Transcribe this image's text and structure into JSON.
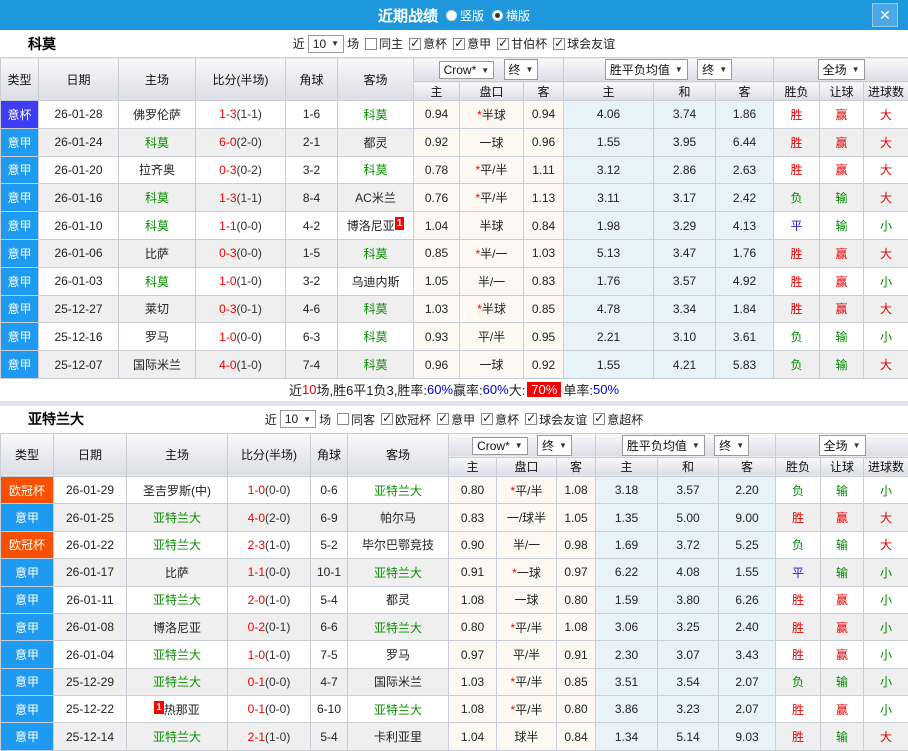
{
  "titlebar": {
    "title": "近期战绩",
    "vertical_label": "竖版",
    "horizontal_label": "横版",
    "close_glyph": "✕"
  },
  "league_colors": {
    "意杯": "#3D3DF5",
    "意甲": "#1E9AF0",
    "欧冠杯": "#F75000"
  },
  "result_colors": {
    "胜": "#E60000",
    "平": "#1A1AE6",
    "负": "#008800",
    "赢": "#E60000",
    "输": "#008800",
    "大": "#E60000",
    "小": "#008800"
  },
  "sections": [
    {
      "team": "科莫",
      "filter": {
        "near_label": "近",
        "count": "10",
        "games_label": "场",
        "same_label": "同主",
        "same_checked": false,
        "leagues": [
          "意杯",
          "意甲",
          "甘伯杯",
          "球会友谊"
        ]
      },
      "selects": {
        "odds_src": "Crow*",
        "odds_time": "终",
        "mean": "胜平负均值",
        "mean_time": "终",
        "scope": "全场"
      },
      "columns": [
        "类型",
        "日期",
        "主场",
        "比分(半场)",
        "角球",
        "客场"
      ],
      "subcols": [
        "主",
        "盘口",
        "客",
        "主",
        "和",
        "客",
        "胜负",
        "让球",
        "进球数"
      ],
      "rows": [
        {
          "league": "意杯",
          "date": "26-01-28",
          "home": "佛罗伦萨",
          "home_sel": false,
          "home_card": "",
          "score": "1-3",
          "half": "(1-1)",
          "corners": "1-6",
          "away": "科莫",
          "away_sel": true,
          "away_card": "",
          "odds_home": "0.94",
          "handicap": "*半球",
          "odds_away": "0.94",
          "avg_home": "4.06",
          "avg_draw": "3.74",
          "avg_away": "1.86",
          "result": "胜",
          "handicap_result": "赢",
          "goals_result": "大"
        },
        {
          "league": "意甲",
          "date": "26-01-24",
          "home": "科莫",
          "home_sel": true,
          "home_card": "",
          "score": "6-0",
          "half": "(2-0)",
          "corners": "2-1",
          "away": "都灵",
          "away_sel": false,
          "away_card": "",
          "odds_home": "0.92",
          "handicap": "一球",
          "odds_away": "0.96",
          "avg_home": "1.55",
          "avg_draw": "3.95",
          "avg_away": "6.44",
          "result": "胜",
          "handicap_result": "赢",
          "goals_result": "大"
        },
        {
          "league": "意甲",
          "date": "26-01-20",
          "home": "拉齐奥",
          "home_sel": false,
          "home_card": "",
          "score": "0-3",
          "half": "(0-2)",
          "corners": "3-2",
          "away": "科莫",
          "away_sel": true,
          "away_card": "",
          "odds_home": "0.78",
          "handicap": "*平/半",
          "odds_away": "1.11",
          "avg_home": "3.12",
          "avg_draw": "2.86",
          "avg_away": "2.63",
          "result": "胜",
          "handicap_result": "赢",
          "goals_result": "大"
        },
        {
          "league": "意甲",
          "date": "26-01-16",
          "home": "科莫",
          "home_sel": true,
          "home_card": "",
          "score": "1-3",
          "half": "(1-1)",
          "corners": "8-4",
          "away": "AC米兰",
          "away_sel": false,
          "away_card": "",
          "odds_home": "0.76",
          "handicap": "*平/半",
          "odds_away": "1.13",
          "avg_home": "3.11",
          "avg_draw": "3.17",
          "avg_away": "2.42",
          "result": "负",
          "handicap_result": "输",
          "goals_result": "大"
        },
        {
          "league": "意甲",
          "date": "26-01-10",
          "home": "科莫",
          "home_sel": true,
          "home_card": "",
          "score": "1-1",
          "half": "(0-0)",
          "corners": "4-2",
          "away": "博洛尼亚",
          "away_sel": false,
          "away_card": "1",
          "odds_home": "1.04",
          "handicap": "半球",
          "odds_away": "0.84",
          "avg_home": "1.98",
          "avg_draw": "3.29",
          "avg_away": "4.13",
          "result": "平",
          "handicap_result": "输",
          "goals_result": "小"
        },
        {
          "league": "意甲",
          "date": "26-01-06",
          "home": "比萨",
          "home_sel": false,
          "home_card": "",
          "score": "0-3",
          "half": "(0-0)",
          "corners": "1-5",
          "away": "科莫",
          "away_sel": true,
          "away_card": "",
          "odds_home": "0.85",
          "handicap": "*半/一",
          "odds_away": "1.03",
          "avg_home": "5.13",
          "avg_draw": "3.47",
          "avg_away": "1.76",
          "result": "胜",
          "handicap_result": "赢",
          "goals_result": "大"
        },
        {
          "league": "意甲",
          "date": "26-01-03",
          "home": "科莫",
          "home_sel": true,
          "home_card": "",
          "score": "1-0",
          "half": "(1-0)",
          "corners": "3-2",
          "away": "乌迪内斯",
          "away_sel": false,
          "away_card": "",
          "odds_home": "1.05",
          "handicap": "半/一",
          "odds_away": "0.83",
          "avg_home": "1.76",
          "avg_draw": "3.57",
          "avg_away": "4.92",
          "result": "胜",
          "handicap_result": "赢",
          "goals_result": "小"
        },
        {
          "league": "意甲",
          "date": "25-12-27",
          "home": "莱切",
          "home_sel": false,
          "home_card": "",
          "score": "0-3",
          "half": "(0-1)",
          "corners": "4-6",
          "away": "科莫",
          "away_sel": true,
          "away_card": "",
          "odds_home": "1.03",
          "handicap": "*半球",
          "odds_away": "0.85",
          "avg_home": "4.78",
          "avg_draw": "3.34",
          "avg_away": "1.84",
          "result": "胜",
          "handicap_result": "赢",
          "goals_result": "大"
        },
        {
          "league": "意甲",
          "date": "25-12-16",
          "home": "罗马",
          "home_sel": false,
          "home_card": "",
          "score": "1-0",
          "half": "(0-0)",
          "corners": "6-3",
          "away": "科莫",
          "away_sel": true,
          "away_card": "",
          "odds_home": "0.93",
          "handicap": "平/半",
          "odds_away": "0.95",
          "avg_home": "2.21",
          "avg_draw": "3.10",
          "avg_away": "3.61",
          "result": "负",
          "handicap_result": "输",
          "goals_result": "小"
        },
        {
          "league": "意甲",
          "date": "25-12-07",
          "home": "国际米兰",
          "home_sel": false,
          "home_card": "",
          "score": "4-0",
          "half": "(1-0)",
          "corners": "7-4",
          "away": "科莫",
          "away_sel": true,
          "away_card": "",
          "odds_home": "0.96",
          "handicap": "一球",
          "odds_away": "0.92",
          "avg_home": "1.55",
          "avg_draw": "4.21",
          "avg_away": "5.83",
          "result": "负",
          "handicap_result": "输",
          "goals_result": "大"
        }
      ],
      "summary": [
        {
          "text": "近",
          "style": "plain"
        },
        {
          "text": "10",
          "style": "red"
        },
        {
          "text": "场,胜6平1负3, ",
          "style": "plain"
        },
        {
          "text": "胜率:",
          "style": "plain"
        },
        {
          "text": "60%",
          "style": "blue"
        },
        {
          "text": " 赢率:",
          "style": "plain"
        },
        {
          "text": "60%",
          "style": "blue"
        },
        {
          "text": " 大:",
          "style": "plain"
        },
        {
          "text": "70%",
          "style": "hl"
        },
        {
          "text": " 单率:",
          "style": "plain"
        },
        {
          "text": "50%",
          "style": "blue"
        }
      ]
    },
    {
      "team": "亚特兰大",
      "filter": {
        "near_label": "近",
        "count": "10",
        "games_label": "场",
        "same_label": "同客",
        "same_checked": false,
        "leagues": [
          "欧冠杯",
          "意甲",
          "意杯",
          "球会友谊",
          "意超杯"
        ]
      },
      "selects": {
        "odds_src": "Crow*",
        "odds_time": "终",
        "mean": "胜平负均值",
        "mean_time": "终",
        "scope": "全场"
      },
      "columns": [
        "类型",
        "日期",
        "主场",
        "比分(半场)",
        "角球",
        "客场"
      ],
      "subcols": [
        "主",
        "盘口",
        "客",
        "主",
        "和",
        "客",
        "胜负",
        "让球",
        "进球数"
      ],
      "rows": [
        {
          "league": "欧冠杯",
          "date": "26-01-29",
          "home": "圣吉罗斯(中)",
          "home_sel": false,
          "home_card": "",
          "score": "1-0",
          "half": "(0-0)",
          "corners": "0-6",
          "away": "亚特兰大",
          "away_sel": true,
          "away_card": "",
          "odds_home": "0.80",
          "handicap": "*平/半",
          "odds_away": "1.08",
          "avg_home": "3.18",
          "avg_draw": "3.57",
          "avg_away": "2.20",
          "result": "负",
          "handicap_result": "输",
          "goals_result": "小"
        },
        {
          "league": "意甲",
          "date": "26-01-25",
          "home": "亚特兰大",
          "home_sel": true,
          "home_card": "",
          "score": "4-0",
          "half": "(2-0)",
          "corners": "6-9",
          "away": "帕尔马",
          "away_sel": false,
          "away_card": "",
          "odds_home": "0.83",
          "handicap": "一/球半",
          "odds_away": "1.05",
          "avg_home": "1.35",
          "avg_draw": "5.00",
          "avg_away": "9.00",
          "result": "胜",
          "handicap_result": "赢",
          "goals_result": "大"
        },
        {
          "league": "欧冠杯",
          "date": "26-01-22",
          "home": "亚特兰大",
          "home_sel": true,
          "home_card": "",
          "score": "2-3",
          "half": "(1-0)",
          "corners": "5-2",
          "away": "毕尔巴鄂竞技",
          "away_sel": false,
          "away_card": "",
          "odds_home": "0.90",
          "handicap": "半/一",
          "odds_away": "0.98",
          "avg_home": "1.69",
          "avg_draw": "3.72",
          "avg_away": "5.25",
          "result": "负",
          "handicap_result": "输",
          "goals_result": "大"
        },
        {
          "league": "意甲",
          "date": "26-01-17",
          "home": "比萨",
          "home_sel": false,
          "home_card": "",
          "score": "1-1",
          "half": "(0-0)",
          "corners": "10-1",
          "away": "亚特兰大",
          "away_sel": true,
          "away_card": "",
          "odds_home": "0.91",
          "handicap": "*一球",
          "odds_away": "0.97",
          "avg_home": "6.22",
          "avg_draw": "4.08",
          "avg_away": "1.55",
          "result": "平",
          "handicap_result": "输",
          "goals_result": "小"
        },
        {
          "league": "意甲",
          "date": "26-01-11",
          "home": "亚特兰大",
          "home_sel": true,
          "home_card": "",
          "score": "2-0",
          "half": "(1-0)",
          "corners": "5-4",
          "away": "都灵",
          "away_sel": false,
          "away_card": "",
          "odds_home": "1.08",
          "handicap": "一球",
          "odds_away": "0.80",
          "avg_home": "1.59",
          "avg_draw": "3.80",
          "avg_away": "6.26",
          "result": "胜",
          "handicap_result": "赢",
          "goals_result": "小"
        },
        {
          "league": "意甲",
          "date": "26-01-08",
          "home": "博洛尼亚",
          "home_sel": false,
          "home_card": "",
          "score": "0-2",
          "half": "(0-1)",
          "corners": "6-6",
          "away": "亚特兰大",
          "away_sel": true,
          "away_card": "",
          "odds_home": "0.80",
          "handicap": "*平/半",
          "odds_away": "1.08",
          "avg_home": "3.06",
          "avg_draw": "3.25",
          "avg_away": "2.40",
          "result": "胜",
          "handicap_result": "赢",
          "goals_result": "小"
        },
        {
          "league": "意甲",
          "date": "26-01-04",
          "home": "亚特兰大",
          "home_sel": true,
          "home_card": "",
          "score": "1-0",
          "half": "(1-0)",
          "corners": "7-5",
          "away": "罗马",
          "away_sel": false,
          "away_card": "",
          "odds_home": "0.97",
          "handicap": "平/半",
          "odds_away": "0.91",
          "avg_home": "2.30",
          "avg_draw": "3.07",
          "avg_away": "3.43",
          "result": "胜",
          "handicap_result": "赢",
          "goals_result": "小"
        },
        {
          "league": "意甲",
          "date": "25-12-29",
          "home": "亚特兰大",
          "home_sel": true,
          "home_card": "",
          "score": "0-1",
          "half": "(0-0)",
          "corners": "4-7",
          "away": "国际米兰",
          "away_sel": false,
          "away_card": "",
          "odds_home": "1.03",
          "handicap": "*平/半",
          "odds_away": "0.85",
          "avg_home": "3.51",
          "avg_draw": "3.54",
          "avg_away": "2.07",
          "result": "负",
          "handicap_result": "输",
          "goals_result": "小"
        },
        {
          "league": "意甲",
          "date": "25-12-22",
          "home": "热那亚",
          "home_sel": false,
          "home_card": "1",
          "score": "0-1",
          "half": "(0-0)",
          "corners": "6-10",
          "away": "亚特兰大",
          "away_sel": true,
          "away_card": "",
          "odds_home": "1.08",
          "handicap": "*平/半",
          "odds_away": "0.80",
          "avg_home": "3.86",
          "avg_draw": "3.23",
          "avg_away": "2.07",
          "result": "胜",
          "handicap_result": "赢",
          "goals_result": "小"
        },
        {
          "league": "意甲",
          "date": "25-12-14",
          "home": "亚特兰大",
          "home_sel": true,
          "home_card": "",
          "score": "2-1",
          "half": "(1-0)",
          "corners": "5-4",
          "away": "卡利亚里",
          "away_sel": false,
          "away_card": "",
          "odds_home": "1.04",
          "handicap": "球半",
          "odds_away": "0.84",
          "avg_home": "1.34",
          "avg_draw": "5.14",
          "avg_away": "9.03",
          "result": "胜",
          "handicap_result": "输",
          "goals_result": "大"
        }
      ],
      "summary": null
    }
  ]
}
